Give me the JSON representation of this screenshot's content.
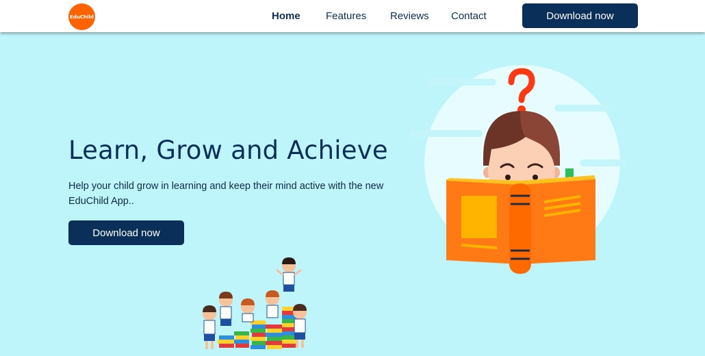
{
  "brand": {
    "logo_text": "EduChild",
    "logo_color": "#ff6200"
  },
  "nav": {
    "links": [
      {
        "label": "Home",
        "active": true
      },
      {
        "label": "Features",
        "active": false
      },
      {
        "label": "Reviews",
        "active": false
      },
      {
        "label": "Contact",
        "active": false
      }
    ],
    "cta_label": "Download now"
  },
  "hero": {
    "title": "Learn, Grow and Achieve",
    "subtitle": "Help your child grow in learning and keep their mind active with the new EduChild App..",
    "cta_label": "Download now"
  },
  "colors": {
    "primary": "#0a2f58",
    "background": "#bdf5fb",
    "accent": "#ff6200"
  },
  "images": {
    "hero_illustration": "child-reading-book-question-illustration",
    "kids_illustration": "kids-on-book-stacks-illustration"
  }
}
